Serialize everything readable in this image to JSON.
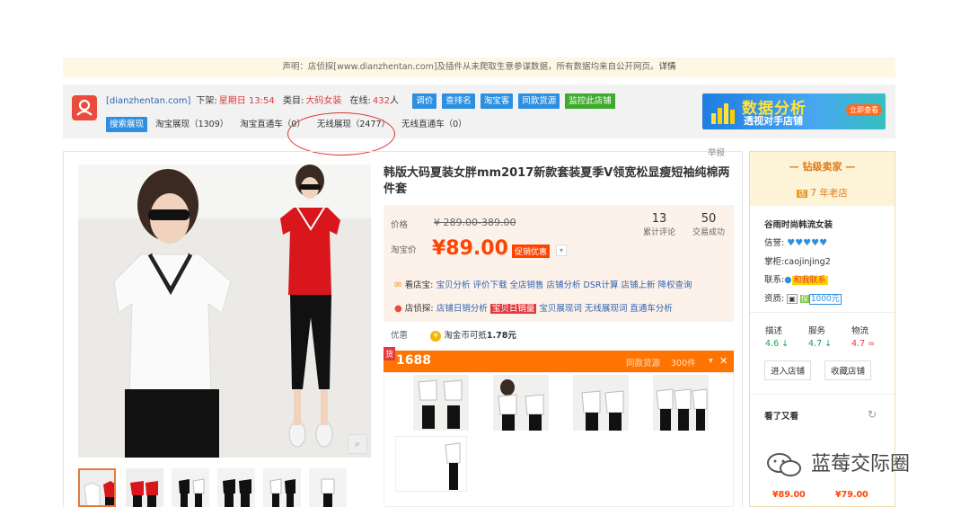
{
  "notice": {
    "text": "声明：店侦探[www.dianzhentan.com]及插件从未爬取生意参谋数据，所有数据均来自公开网页。",
    "link": "详情"
  },
  "toolbar": {
    "site": "[dianzhentan.com]",
    "listed_label": "下架:",
    "listed_value": "星期日 13:54",
    "category_label": "类目:",
    "category_value": "大码女装",
    "online_label": "在线:",
    "online_value": "432",
    "online_unit": "人",
    "buttons": [
      "调价",
      "查排名",
      "淘宝客",
      "同款货源"
    ],
    "monitor_button": "监控此店铺",
    "search_button": "搜索展现",
    "links": [
      {
        "label": "淘宝展现",
        "count": "（1309）"
      },
      {
        "label": "淘宝直通车",
        "count": "（0）"
      },
      {
        "label": "无线展现",
        "count": "（2477）"
      },
      {
        "label": "无线直通车",
        "count": "（0）"
      }
    ]
  },
  "ad": {
    "line1": "数据分析",
    "line2": "透视对手店铺",
    "cta": "立即查看"
  },
  "report": "举报",
  "product": {
    "title": "韩版大码夏装女胖mm2017新款套装夏季V领宽松显瘦短袖纯棉两件套",
    "price_label": "价格",
    "price_range": "¥ 289.00-389.00",
    "taobao_price_label": "淘宝价",
    "taobao_price": "¥89.00",
    "promo": "促销优惠",
    "reviews_count": "13",
    "reviews_label": "累计评论",
    "sales_count": "50",
    "sales_label": "交易成功",
    "kandianbao_label": "看店宝:",
    "kandianbao_links": [
      "宝贝分析",
      "评价下载",
      "全店销售",
      "店铺分析",
      "DSR计算",
      "店铺上新",
      "降权查询"
    ],
    "dianzhentan_label": "店侦探:",
    "dianzhentan_links": [
      "店铺日销分析",
      "宝贝日销量",
      "宝贝展现词",
      "无线展现词",
      "直通车分析"
    ],
    "offer_label": "优惠",
    "offer_text": "淘金币可抵",
    "offer_value": "1.78元"
  },
  "supply": {
    "brand": "1688",
    "badge": "货",
    "same_source": "同款货源",
    "count": "300件",
    "close": "✕"
  },
  "sidebar": {
    "header": "钻级卖家",
    "years": "7 年老店",
    "shop_name": "谷雨时尚韩流女装",
    "credit_label": "信誉:",
    "owner_label": "掌柜:",
    "owner": "caojinjing2",
    "contact_label": "联系:",
    "contact": "和我联系",
    "qual_label": "资质:",
    "deposit": "1000元",
    "ratings": [
      {
        "label": "描述",
        "value": "4.6",
        "arrow": "↓",
        "color": "#1a9d5a"
      },
      {
        "label": "服务",
        "value": "4.7",
        "arrow": "↓",
        "color": "#1a9d5a"
      },
      {
        "label": "物流",
        "value": "4.7",
        "arrow": "=",
        "color": "#e4393c"
      }
    ],
    "enter_shop": "进入店铺",
    "fav_shop": "收藏店铺",
    "seen_label": "看了又看",
    "prices": [
      "¥89.00",
      "¥79.00"
    ]
  },
  "watermark": "蓝莓交际圈"
}
